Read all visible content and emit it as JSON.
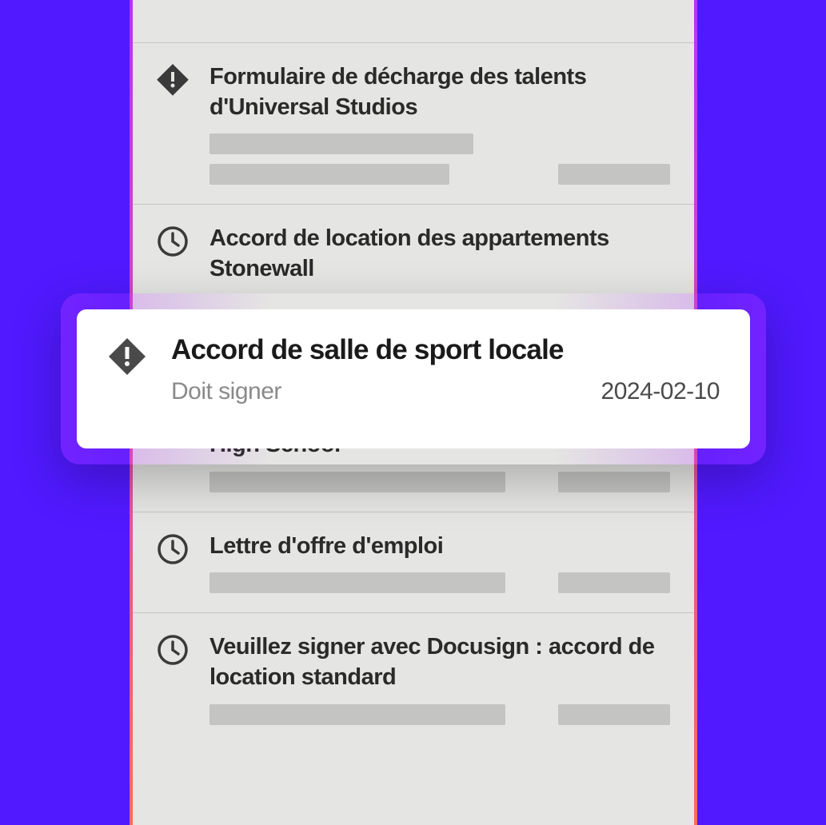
{
  "list": {
    "items": [
      {
        "title": "",
        "icon": "none"
      },
      {
        "title": "Formulaire de décharge des talents d'Universal Studios",
        "icon": "alert"
      },
      {
        "title": "Accord de location des appartements Stonewall",
        "icon": "clock"
      },
      {
        "title": "Billet pour sortie scolaire du Maplewood High School",
        "icon": "check"
      },
      {
        "title": "Lettre d'offre d'emploi",
        "icon": "clock"
      },
      {
        "title": "Veuillez signer avec Docusign : accord de location standard",
        "icon": "clock"
      }
    ]
  },
  "featured": {
    "title": "Accord de salle de sport locale",
    "status": "Doit signer",
    "date": "2024-02-10"
  }
}
